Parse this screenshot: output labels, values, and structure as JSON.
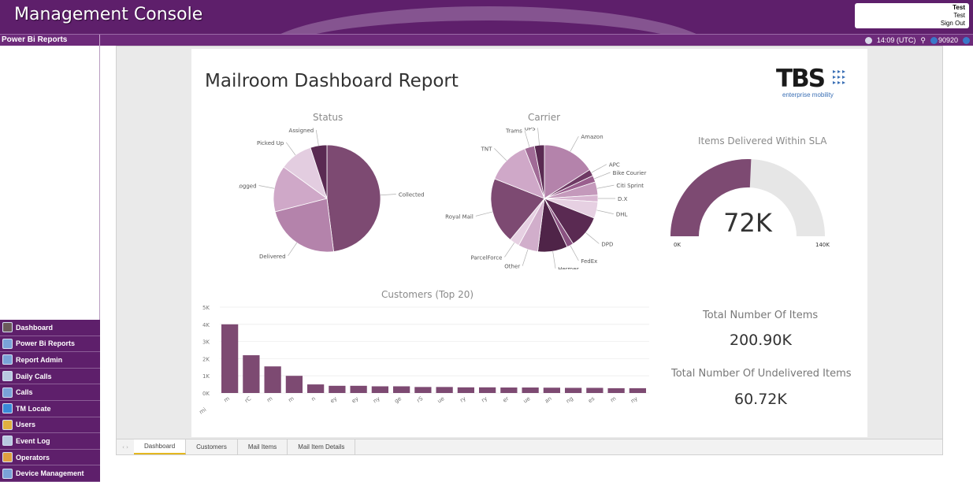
{
  "app": {
    "title": "Management Console"
  },
  "user": {
    "name": "Test",
    "role": "Test",
    "sign_out": "Sign Out"
  },
  "subbar": {
    "section": "Power Bi Reports",
    "time": "14:09 (UTC)",
    "session": "90920"
  },
  "nav": {
    "items": [
      {
        "label": "Dashboard",
        "icon": "dashboard-icon",
        "color": "#6b5a5a"
      },
      {
        "label": "Power Bi Reports",
        "icon": "report-icon",
        "color": "#7aa3d8"
      },
      {
        "label": "Report Admin",
        "icon": "report-admin-icon",
        "color": "#7aa3d8"
      },
      {
        "label": "Daily Calls",
        "icon": "calendar-icon",
        "color": "#b8c8e0"
      },
      {
        "label": "Calls",
        "icon": "phone-icon",
        "color": "#7aa3d8"
      },
      {
        "label": "TM Locate",
        "icon": "globe-icon",
        "color": "#3a8ad8"
      },
      {
        "label": "Users",
        "icon": "users-icon",
        "color": "#e0b040"
      },
      {
        "label": "Event Log",
        "icon": "log-icon",
        "color": "#b8c8e0"
      },
      {
        "label": "Operators",
        "icon": "operators-icon",
        "color": "#e0a040"
      },
      {
        "label": "Device Management",
        "icon": "device-icon",
        "color": "#7aa3d8"
      }
    ]
  },
  "report": {
    "title": "Mailroom Dashboard Report",
    "logo": {
      "brand": "TBS",
      "tagline": "enterprise mobility"
    },
    "status_title": "Status",
    "carrier_title": "Carrier",
    "sla_title": "Items Delivered Within SLA",
    "customers_title": "Customers (Top 20)",
    "total_label": "Total Number Of Items",
    "total_value": "200.90K",
    "undelivered_label": "Total Number Of Undelivered Items",
    "undelivered_value": "60.72K"
  },
  "tabs": [
    {
      "label": "Dashboard",
      "active": true
    },
    {
      "label": "Customers",
      "active": false
    },
    {
      "label": "Mail Items",
      "active": false
    },
    {
      "label": "Mail Item Details",
      "active": false
    }
  ],
  "chart_data": [
    {
      "type": "pie",
      "title": "Status",
      "labels": [
        "Collected",
        "Delivered",
        "Logged",
        "Picked Up",
        "Assigned"
      ],
      "values": [
        48,
        23,
        14,
        10,
        5
      ],
      "colors": [
        "#7d4a72",
        "#b483ab",
        "#cfa8c8",
        "#e3cde0",
        "#5a2a52"
      ]
    },
    {
      "type": "pie",
      "title": "Carrier",
      "labels": [
        "Amazon",
        "APC",
        "Bike Courier",
        "Citi Sprint",
        "D.X",
        "DHL",
        "DPD",
        "FedEx",
        "Hermes",
        "Other",
        "ParcelForce",
        "Royal Mail",
        "TNT",
        "Trams",
        "UPS"
      ],
      "values": [
        16,
        2,
        2,
        4,
        2,
        5,
        10,
        2,
        9,
        6,
        3,
        20,
        13,
        3,
        3
      ],
      "colors": [
        "#b483ab",
        "#6e3a64",
        "#9a5f8e",
        "#c499bb",
        "#d8b6d1",
        "#e6d0e2",
        "#5a2a52",
        "#8a5281",
        "#4f2448",
        "#d1aecb",
        "#e6d0e2",
        "#7d4a72",
        "#cfa8c8",
        "#a06a96",
        "#5a2a52"
      ]
    },
    {
      "type": "gauge",
      "title": "Items Delivered Within SLA",
      "value": 72,
      "value_label": "72K",
      "min_label": "0K",
      "max_label": "140K",
      "min": 0,
      "max": 140,
      "fill": "#7d4a72",
      "track": "#e6e6e6"
    },
    {
      "type": "bar",
      "title": "Customers (Top 20)",
      "y_ticks": [
        "5K",
        "4K",
        "3K",
        "2K",
        "1K",
        "0K"
      ],
      "ylim": [
        0,
        5
      ],
      "values": [
        4.0,
        2.2,
        1.55,
        1.0,
        0.5,
        0.42,
        0.42,
        0.39,
        0.39,
        0.35,
        0.35,
        0.33,
        0.33,
        0.32,
        0.32,
        0.31,
        0.3,
        0.3,
        0.28,
        0.28
      ],
      "tick_labels": [
        "m",
        "rC",
        "m",
        "m",
        "n",
        "ey",
        "ey",
        "ny",
        "ge",
        "rS",
        "ue",
        "ry",
        "ry",
        "er",
        "ue",
        "an",
        "ng",
        "es",
        "m",
        "ny"
      ],
      "first_label": "mi",
      "color": "#7d4a72"
    }
  ]
}
